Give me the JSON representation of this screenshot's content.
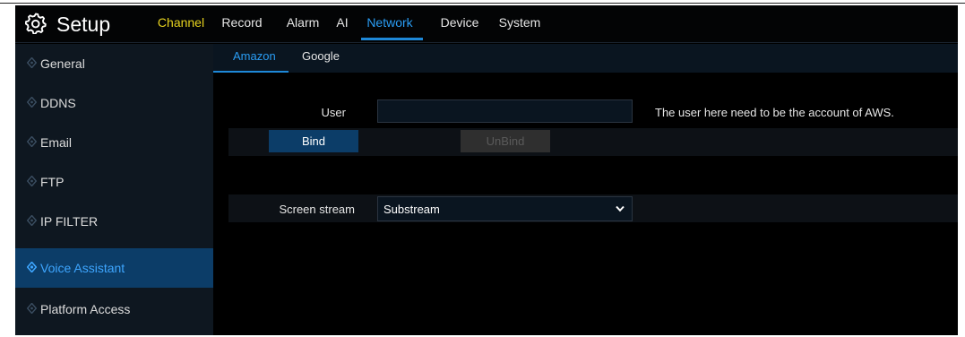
{
  "header": {
    "title": "Setup",
    "nav": [
      {
        "label": "Channel"
      },
      {
        "label": "Record"
      },
      {
        "label": "Alarm"
      },
      {
        "label": "AI"
      },
      {
        "label": "Network",
        "active": true
      },
      {
        "label": "Device"
      },
      {
        "label": "System"
      }
    ]
  },
  "sidebar": {
    "items": [
      {
        "label": "General"
      },
      {
        "label": "DDNS"
      },
      {
        "label": "Email"
      },
      {
        "label": "FTP"
      },
      {
        "label": "IP FILTER"
      },
      {
        "label": "Voice Assistant",
        "active": true
      },
      {
        "label": "Platform Access"
      }
    ]
  },
  "subtabs": [
    {
      "label": "Amazon",
      "active": true
    },
    {
      "label": "Google"
    }
  ],
  "form": {
    "user_label": "User",
    "user_value": "",
    "user_hint": "The user here need to be the account of AWS.",
    "bind_label": "Bind",
    "unbind_label": "UnBind",
    "stream_label": "Screen stream",
    "stream_value": "Substream"
  },
  "colors": {
    "accent": "#2a9df4",
    "channel_highlight": "#e6d21e",
    "active_bg": "#0c3d68",
    "sidebar_bg": "#0e1720"
  }
}
